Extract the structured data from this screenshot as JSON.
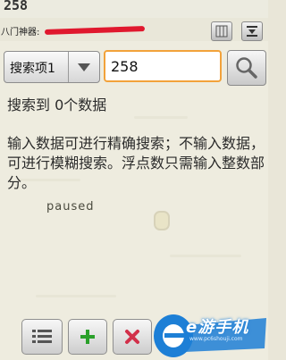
{
  "game": {
    "score": "258",
    "paused_label": "paused"
  },
  "header": {
    "title": "八门神器:"
  },
  "search": {
    "select_value": "搜索项1",
    "input_value": "258",
    "search_icon": "magnifier-icon"
  },
  "results": {
    "summary": "搜索到 0个数据",
    "hint": "输入数据可进行精确搜索；不输入数据，可进行模糊搜索。浮点数只需输入整数部分。"
  },
  "toolbar": {
    "list_icon": "list-icon",
    "add_icon": "plus-icon",
    "remove_icon": "close-icon"
  },
  "watermark": {
    "text": "e游手机",
    "sub": "www.pc6shouji.com"
  },
  "colors": {
    "accent": "#f2a23a",
    "add": "#2aa02a",
    "remove": "#d2304a",
    "redaction": "#e0182e"
  }
}
